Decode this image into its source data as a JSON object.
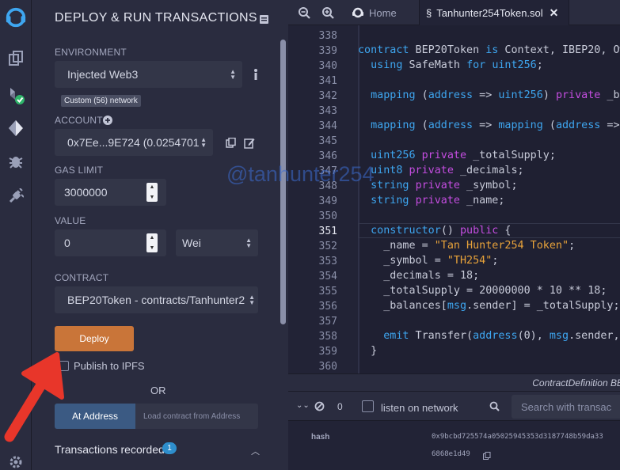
{
  "panel": {
    "title": "DEPLOY & RUN TRANSACTIONS",
    "environment_label": "ENVIRONMENT",
    "environment_value": "Injected Web3",
    "network_badge": "Custom (56) network",
    "account_label": "ACCOUNT",
    "account_value": "0x7Ee...9E724 (0.0254701",
    "gas_limit_label": "GAS LIMIT",
    "gas_limit_value": "3000000",
    "value_label": "VALUE",
    "value_amount": "0",
    "value_unit": "Wei",
    "contract_label": "CONTRACT",
    "contract_value": "BEP20Token - contracts/Tanhunter2",
    "deploy_label": "Deploy",
    "publish_label": "Publish to IPFS",
    "or_label": "OR",
    "at_address_label": "At Address",
    "at_address_placeholder": "Load contract from Address",
    "transactions_label": "Transactions recorded",
    "transactions_count": "1"
  },
  "tabs": {
    "home_label": "Home",
    "file_label": "Tanhunter254Token.sol"
  },
  "code_lines": [
    {
      "n": "338",
      "t": ""
    },
    {
      "n": "339",
      "t": "contract BEP20Token is Context, IBEP20, Ow"
    },
    {
      "n": "340",
      "t": "  using SafeMath for uint256;"
    },
    {
      "n": "341",
      "t": ""
    },
    {
      "n": "342",
      "t": "  mapping (address => uint256) private _ba"
    },
    {
      "n": "343",
      "t": ""
    },
    {
      "n": "344",
      "t": "  mapping (address => mapping (address =>"
    },
    {
      "n": "345",
      "t": ""
    },
    {
      "n": "346",
      "t": "  uint256 private _totalSupply;"
    },
    {
      "n": "347",
      "t": "  uint8 private _decimals;"
    },
    {
      "n": "348",
      "t": "  string private _symbol;"
    },
    {
      "n": "349",
      "t": "  string private _name;"
    },
    {
      "n": "350",
      "t": ""
    },
    {
      "n": "351",
      "t": "  constructor() public {"
    },
    {
      "n": "352",
      "t": "    _name = \"Tan Hunter254 Token\";"
    },
    {
      "n": "353",
      "t": "    _symbol = \"TH254\";"
    },
    {
      "n": "354",
      "t": "    _decimals = 18;"
    },
    {
      "n": "355",
      "t": "    _totalSupply = 20000000 * 10 ** 18;"
    },
    {
      "n": "356",
      "t": "    _balances[msg.sender] = _totalSupply;"
    },
    {
      "n": "357",
      "t": ""
    },
    {
      "n": "358",
      "t": "    emit Transfer(address(0), msg.sender,"
    },
    {
      "n": "359",
      "t": "  }"
    },
    {
      "n": "360",
      "t": ""
    }
  ],
  "terminal": {
    "context_label": "ContractDefinition BE",
    "count": "0",
    "listen_label": "listen on network",
    "search_placeholder": "Search with transac",
    "hash_label": "hash",
    "hash_value_1": "0x9bcbd725574a05025945353d3187748b59da33",
    "hash_value_2": "6868e1d49"
  },
  "watermark": "@tanhunter254",
  "colors": {
    "accent_deploy": "#c97539",
    "accent_at_address": "#3b5a83",
    "keyword": "#3ea6f0",
    "string": "#e9a33a",
    "annotation_arrow": "#e8362a"
  }
}
